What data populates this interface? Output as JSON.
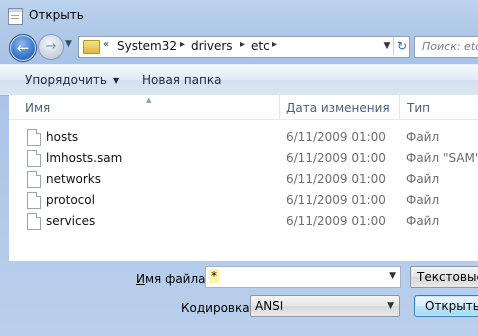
{
  "window": {
    "title": "Открыть",
    "app_icon": "notepad-icon"
  },
  "navigation": {
    "back_icon": "back-arrow-icon",
    "forward_icon": "forward-arrow-icon",
    "breadcrumb": [
      "System32",
      "drivers",
      "etc"
    ],
    "search_placeholder": "Поиск: etc"
  },
  "toolbar": {
    "organize_label": "Упорядочить",
    "new_folder_label": "Новая папка"
  },
  "columns": {
    "name": "Имя",
    "date": "Дата изменения",
    "type": "Тип"
  },
  "files": [
    {
      "name": "hosts",
      "date": "6/11/2009 01:00",
      "type": "Файл"
    },
    {
      "name": "lmhosts.sam",
      "date": "6/11/2009 01:00",
      "type": "Файл \"SAM\""
    },
    {
      "name": "networks",
      "date": "6/11/2009 01:00",
      "type": "Файл"
    },
    {
      "name": "protocol",
      "date": "6/11/2009 01:00",
      "type": "Файл"
    },
    {
      "name": "services",
      "date": "6/11/2009 01:00",
      "type": "Файл"
    }
  ],
  "bottom": {
    "filename_label_prefix": "И",
    "filename_label_rest": "мя файла:",
    "filename_value": "*",
    "filetype_label": "Текстовые документы (*.txt)",
    "encoding_label": "Кодировка:",
    "encoding_value": "ANSI",
    "open_button": "Открыть"
  }
}
